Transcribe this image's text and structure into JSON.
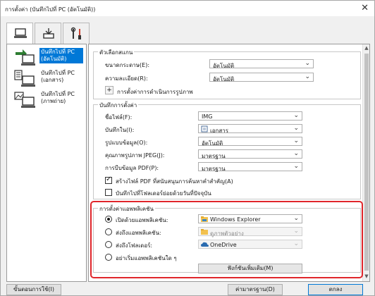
{
  "window": {
    "title": "การตั้งค่า (บันทึกไปที่ PC (อัตโนมัติ))",
    "close_glyph": "✕"
  },
  "top_tabs": [
    {
      "icon": "scan-to-pc-icon",
      "active": true
    },
    {
      "icon": "scan-from-operation-panel-icon",
      "active": false
    },
    {
      "icon": "general-settings-tools-icon",
      "active": false
    }
  ],
  "left_items": [
    {
      "label": "บันทึกไปที่ PC (อัตโนมัติ)",
      "selected": true
    },
    {
      "label": "บันทึกไปที่ PC (เอกสาร)",
      "selected": false
    },
    {
      "label": "บันทึกไปที่ PC (ภาพถ่าย)",
      "selected": false
    }
  ],
  "scan_options": {
    "group_title": "ตัวเลือกสแกน",
    "paper_size": {
      "label": "ขนาดกระดาษ(E):",
      "value": "อัตโนมัติ"
    },
    "resolution": {
      "label": "ความละเอียด(R):",
      "value": "อัตโนมัติ"
    },
    "image_processing": {
      "label": "การตั้งค่าการดำเนินการรูปภาพ",
      "toggle": "+"
    }
  },
  "save_settings": {
    "group_title": "บันทึกการตั้งค่า",
    "file_name": {
      "label": "ชื่อไฟล์(F):",
      "value": "IMG"
    },
    "save_in": {
      "label": "บันทึกใน(I):",
      "value": "เอกสาร"
    },
    "data_format": {
      "label": "รูปแบบข้อมูล(O):",
      "value": "อัตโนมัติ"
    },
    "jpeg_quality": {
      "label": "คุณภาพรูปภาพ JPEG(J):",
      "value": "มาตรฐาน"
    },
    "pdf_compression": {
      "label": "การบีบข้อมูล PDF(P):",
      "value": "มาตรฐาน"
    },
    "keyword_pdf": {
      "label": "สร้างไฟล์ PDF ที่สนับสนุนการค้นหาคำสำคัญ(A)",
      "checked": true
    },
    "save_subfolder": {
      "label": "บันทึกไปที่โฟลเดอร์ย่อยด้วยวันที่ปัจจุบัน",
      "checked": false
    }
  },
  "app_settings": {
    "group_title": "การตั้งค่าแอพพลิเคชัน",
    "open_app": {
      "label": "เปิดด้วยแอพพลิเคชัน:",
      "value": "Windows Explorer",
      "selected": true
    },
    "send_app": {
      "label": "ส่งถึงแอพพลิเคชัน:",
      "value": "ดูภาพตัวอย่าง",
      "selected": false
    },
    "send_folder": {
      "label": "ส่งถึงโฟลเดอร์:",
      "value": "OneDrive",
      "selected": false
    },
    "no_app": {
      "label": "อย่าเริ่มแอพพลิเคชันใด ๆ",
      "selected": false
    },
    "more_functions_button": "ฟังก์ชันเพิ่มเติม(M)"
  },
  "footer": {
    "instructions_button": "ขั้นตอนการใช้(I)",
    "defaults_button": "ค่ามาตรฐาน(D)",
    "ok_button": "ตกลง"
  },
  "colors": {
    "selection": "#0078d7",
    "highlight_box": "#e0262b"
  }
}
